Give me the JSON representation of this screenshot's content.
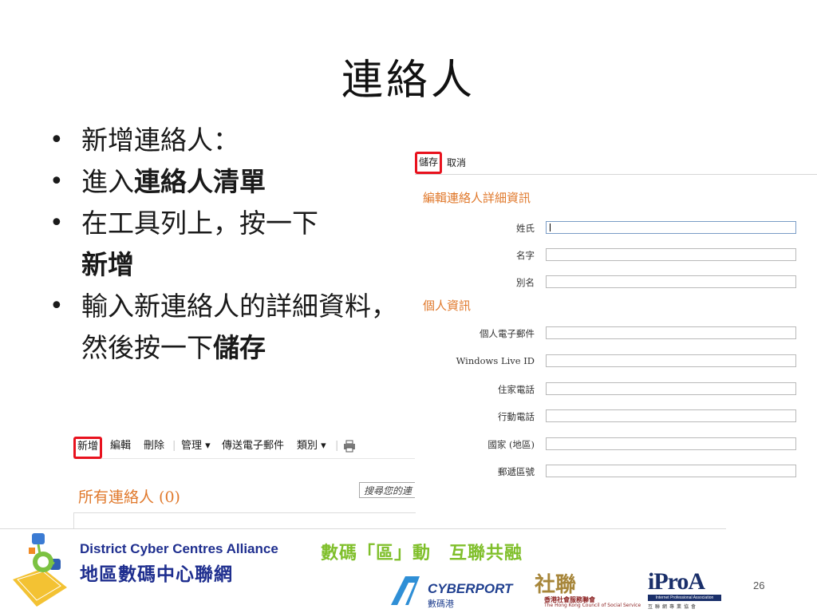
{
  "slide": {
    "title": "連絡人",
    "page_number": "26"
  },
  "bullets": [
    {
      "pre": "新增連絡人：",
      "bold": ""
    },
    {
      "pre": "進入",
      "bold": "連絡人清單"
    },
    {
      "pre": "在工具列上，按一下",
      "bold": "新增"
    },
    {
      "pre": "輸入新連絡人的詳細資料，然後按一下",
      "bold": "儲存"
    }
  ],
  "contact_editor": {
    "toolbar": {
      "save": "儲存",
      "cancel": "取消"
    },
    "section_edit": "編輯連絡人詳細資訊",
    "section_personal": "個人資訊",
    "fields": [
      {
        "label": "姓氏",
        "value": ""
      },
      {
        "label": "名字",
        "value": ""
      },
      {
        "label": "別名",
        "value": ""
      },
      {
        "label": "個人電子郵件",
        "value": ""
      },
      {
        "label": "Windows Live ID",
        "value": ""
      },
      {
        "label": "住家電話",
        "value": ""
      },
      {
        "label": "行動電話",
        "value": ""
      },
      {
        "label": "國家 (地區)",
        "value": ""
      },
      {
        "label": "郵遞區號",
        "value": ""
      }
    ]
  },
  "contact_list": {
    "toolbar": {
      "new": "新增",
      "edit": "編輯",
      "delete": "刪除",
      "manage": "管理 ▾",
      "send_email": "傳送電子郵件",
      "category": "類別 ▾"
    },
    "title": "所有連絡人 (0)",
    "search_placeholder": "搜尋您的連"
  },
  "footer": {
    "org_en": "District Cyber Centres Alliance",
    "org_zh": "地區數碼中心聯網",
    "slogan": "數碼「區」動　互聯共融",
    "cyberport_en": "CYBERPORT",
    "cyberport_zh": "數碼港",
    "hkcss_mark": "社聯",
    "hkcss_zh": "香港社會服務聯會",
    "hkcss_en": "The Hong Kong Council of Social Service",
    "ipro_mark": "iProA",
    "ipro_en": "Internet Professional Association",
    "ipro_zh": "互聯網專業協會"
  },
  "colors": {
    "accent_orange": "#e0792c",
    "highlight_red": "#e8121e",
    "brand_blue": "#1f2f8f",
    "slogan_green": "#7fbf2a"
  }
}
